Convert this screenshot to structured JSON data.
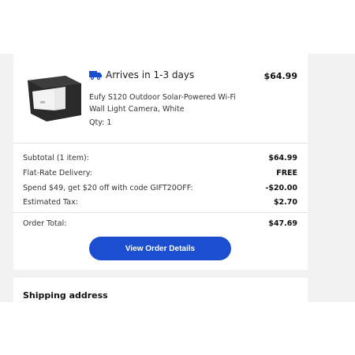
{
  "shipment": {
    "arrives_text": "Arrives in 1-3 days",
    "truck_icon": "truck-icon",
    "price": "$64.99",
    "product_name": "Eufy S120 Outdoor Solar-Powered Wi-Fi Wall Light Camera, White",
    "qty": "Qty: 1"
  },
  "summary": {
    "rows": [
      {
        "label": "Subtotal (1 item):",
        "value": "$64.99"
      },
      {
        "label": "Flat-Rate Delivery:",
        "value": "FREE"
      },
      {
        "label": "Spend $49, get $20 off with code GIFT20OFF:",
        "value": "-$20.00"
      },
      {
        "label": "Estimated Tax:",
        "value": "$2.70"
      }
    ],
    "total_label": "Order Total:",
    "total_value": "$47.69"
  },
  "actions": {
    "view_order_label": "View Order Details"
  },
  "shipping": {
    "title": "Shipping address"
  },
  "colors": {
    "accent": "#1b4fd0",
    "background": "#f2f2f2"
  }
}
